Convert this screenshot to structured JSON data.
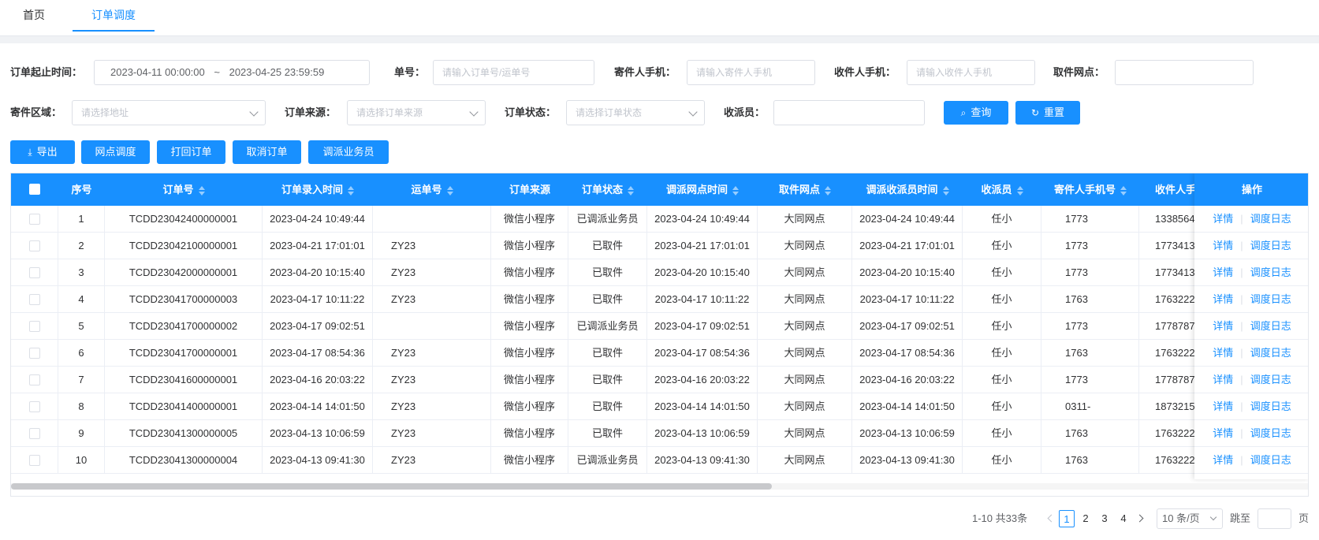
{
  "tabs": [
    {
      "label": "首页",
      "active": false
    },
    {
      "label": "订单调度",
      "active": true
    }
  ],
  "filters": {
    "order_time_label": "订单起止时间：",
    "order_time_start": "2023-04-11 00:00:00",
    "order_time_sep": "~",
    "order_time_end": "2023-04-25 23:59:59",
    "order_no_label": "单号：",
    "order_no_placeholder": "请输入订单号/运单号",
    "sender_phone_label": "寄件人手机：",
    "sender_phone_placeholder": "请输入寄件人手机",
    "receiver_phone_label": "收件人手机：",
    "receiver_phone_placeholder": "请输入收件人手机",
    "pickup_point_label": "取件网点：",
    "pickup_point_value": "",
    "sender_region_label": "寄件区域：",
    "sender_region_placeholder": "请选择地址",
    "order_source_label": "订单来源：",
    "order_source_placeholder": "请选择订单来源",
    "order_status_label": "订单状态：",
    "order_status_placeholder": "请选择订单状态",
    "courier_label": "收派员：",
    "courier_value": "",
    "search_button": "查询",
    "reset_button": "重置"
  },
  "toolbar": {
    "export": "导出",
    "dispatch_point": "网点调度",
    "return_order": "打回订单",
    "cancel_order": "取消订单",
    "dispatch_staff": "调派业务员"
  },
  "table": {
    "columns": [
      "序号",
      "订单号",
      "订单录入时间",
      "运单号",
      "订单来源",
      "订单状态",
      "调派网点时间",
      "取件网点",
      "调派收派员时间",
      "收派员",
      "寄件人手机号",
      "收件人手机号"
    ],
    "ops_column": "操作",
    "op_detail": "详情",
    "op_log": "调度日志",
    "rows": [
      {
        "no": "1",
        "order": "TCDD23042400000001",
        "entry": "2023-04-24 10:49:44",
        "waybill": "",
        "source": "微信小程序",
        "status": "已调派业务员",
        "dispatch_time": "2023-04-24 10:49:44",
        "point": "大同网点",
        "courier_time": "2023-04-24 10:49:44",
        "courier": "任小",
        "sender": "1773",
        "receiver": "1338564"
      },
      {
        "no": "2",
        "order": "TCDD23042100000001",
        "entry": "2023-04-21 17:01:01",
        "waybill": "ZY23",
        "source": "微信小程序",
        "status": "已取件",
        "dispatch_time": "2023-04-21 17:01:01",
        "point": "大同网点",
        "courier_time": "2023-04-21 17:01:01",
        "courier": "任小",
        "sender": "1773",
        "receiver": "1773413"
      },
      {
        "no": "3",
        "order": "TCDD23042000000001",
        "entry": "2023-04-20 10:15:40",
        "waybill": "ZY23",
        "source": "微信小程序",
        "status": "已取件",
        "dispatch_time": "2023-04-20 10:15:40",
        "point": "大同网点",
        "courier_time": "2023-04-20 10:15:40",
        "courier": "任小",
        "sender": "1773",
        "receiver": "1773413"
      },
      {
        "no": "4",
        "order": "TCDD23041700000003",
        "entry": "2023-04-17 10:11:22",
        "waybill": "ZY23",
        "source": "微信小程序",
        "status": "已取件",
        "dispatch_time": "2023-04-17 10:11:22",
        "point": "大同网点",
        "courier_time": "2023-04-17 10:11:22",
        "courier": "任小",
        "sender": "1763",
        "receiver": "1763222"
      },
      {
        "no": "5",
        "order": "TCDD23041700000002",
        "entry": "2023-04-17 09:02:51",
        "waybill": "",
        "source": "微信小程序",
        "status": "已调派业务员",
        "dispatch_time": "2023-04-17 09:02:51",
        "point": "大同网点",
        "courier_time": "2023-04-17 09:02:51",
        "courier": "任小",
        "sender": "1773",
        "receiver": "1778787"
      },
      {
        "no": "6",
        "order": "TCDD23041700000001",
        "entry": "2023-04-17 08:54:36",
        "waybill": "ZY23",
        "source": "微信小程序",
        "status": "已取件",
        "dispatch_time": "2023-04-17 08:54:36",
        "point": "大同网点",
        "courier_time": "2023-04-17 08:54:36",
        "courier": "任小",
        "sender": "1763",
        "receiver": "1763222"
      },
      {
        "no": "7",
        "order": "TCDD23041600000001",
        "entry": "2023-04-16 20:03:22",
        "waybill": "ZY23",
        "source": "微信小程序",
        "status": "已取件",
        "dispatch_time": "2023-04-16 20:03:22",
        "point": "大同网点",
        "courier_time": "2023-04-16 20:03:22",
        "courier": "任小",
        "sender": "1773",
        "receiver": "1778787"
      },
      {
        "no": "8",
        "order": "TCDD23041400000001",
        "entry": "2023-04-14 14:01:50",
        "waybill": "ZY23",
        "source": "微信小程序",
        "status": "已取件",
        "dispatch_time": "2023-04-14 14:01:50",
        "point": "大同网点",
        "courier_time": "2023-04-14 14:01:50",
        "courier": "任小",
        "sender": "0311-",
        "receiver": "1873215"
      },
      {
        "no": "9",
        "order": "TCDD23041300000005",
        "entry": "2023-04-13 10:06:59",
        "waybill": "ZY23",
        "source": "微信小程序",
        "status": "已取件",
        "dispatch_time": "2023-04-13 10:06:59",
        "point": "大同网点",
        "courier_time": "2023-04-13 10:06:59",
        "courier": "任小",
        "sender": "1763",
        "receiver": "1763222"
      },
      {
        "no": "10",
        "order": "TCDD23041300000004",
        "entry": "2023-04-13 09:41:30",
        "waybill": "ZY23",
        "source": "微信小程序",
        "status": "已调派业务员",
        "dispatch_time": "2023-04-13 09:41:30",
        "point": "大同网点",
        "courier_time": "2023-04-13 09:41:30",
        "courier": "任小",
        "sender": "1763",
        "receiver": "1763222"
      }
    ]
  },
  "pagination": {
    "summary": "1-10 共33条",
    "pages": [
      "1",
      "2",
      "3",
      "4"
    ],
    "current": "1",
    "page_size": "10 条/页",
    "jump_label": "跳至",
    "page_unit": "页"
  },
  "colors": {
    "primary": "#1890ff",
    "header_bg": "#1890ff",
    "link": "#1890ff"
  }
}
